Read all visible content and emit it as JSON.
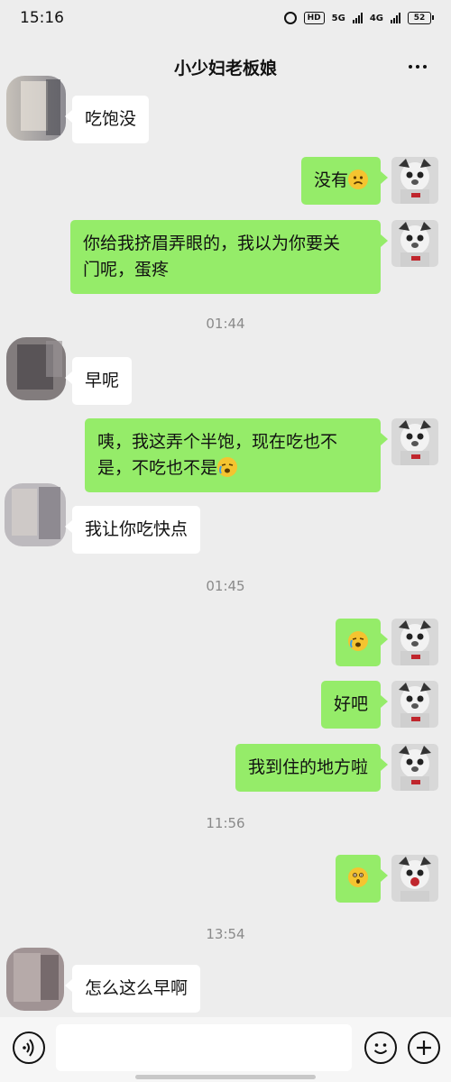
{
  "status_bar": {
    "time": "15:16",
    "hd_label": "HD",
    "network_1": "5G",
    "network_2": "4G",
    "battery": "52"
  },
  "header": {
    "title": "小少妇老板娘"
  },
  "messages": [
    {
      "type": "message",
      "sender": "other",
      "text": "吃饱没"
    },
    {
      "type": "message",
      "sender": "me",
      "text": "没有",
      "emoji": "frowning-face-emoji"
    },
    {
      "type": "message",
      "sender": "me",
      "line1": "你给我挤眉弄眼的，我以为你要关",
      "line2": "门呢，蛋疼"
    },
    {
      "type": "time",
      "text": "01:44"
    },
    {
      "type": "message",
      "sender": "other",
      "text": "早呢"
    },
    {
      "type": "message",
      "sender": "me",
      "line1": "咦，我这弄个半饱，现在吃也不",
      "line2": "是，不吃也不是",
      "emoji": "crying-face-emoji"
    },
    {
      "type": "message",
      "sender": "other",
      "text": "我让你吃快点"
    },
    {
      "type": "time",
      "text": "01:45"
    },
    {
      "type": "message",
      "sender": "me",
      "text": "",
      "emoji": "crying-face-emoji"
    },
    {
      "type": "message",
      "sender": "me",
      "text": "好吧"
    },
    {
      "type": "message",
      "sender": "me",
      "text": "我到住的地方啦"
    },
    {
      "type": "time",
      "text": "11:56"
    },
    {
      "type": "message",
      "sender": "me",
      "text": "",
      "emoji": "shocked-face-emoji"
    },
    {
      "type": "time",
      "text": "13:54"
    },
    {
      "type": "message",
      "sender": "other",
      "text": "怎么这么早啊"
    }
  ],
  "input_bar": {
    "placeholder": ""
  },
  "colors": {
    "background": "#ededed",
    "my_bubble": "#95ec69",
    "other_bubble": "#ffffff"
  }
}
